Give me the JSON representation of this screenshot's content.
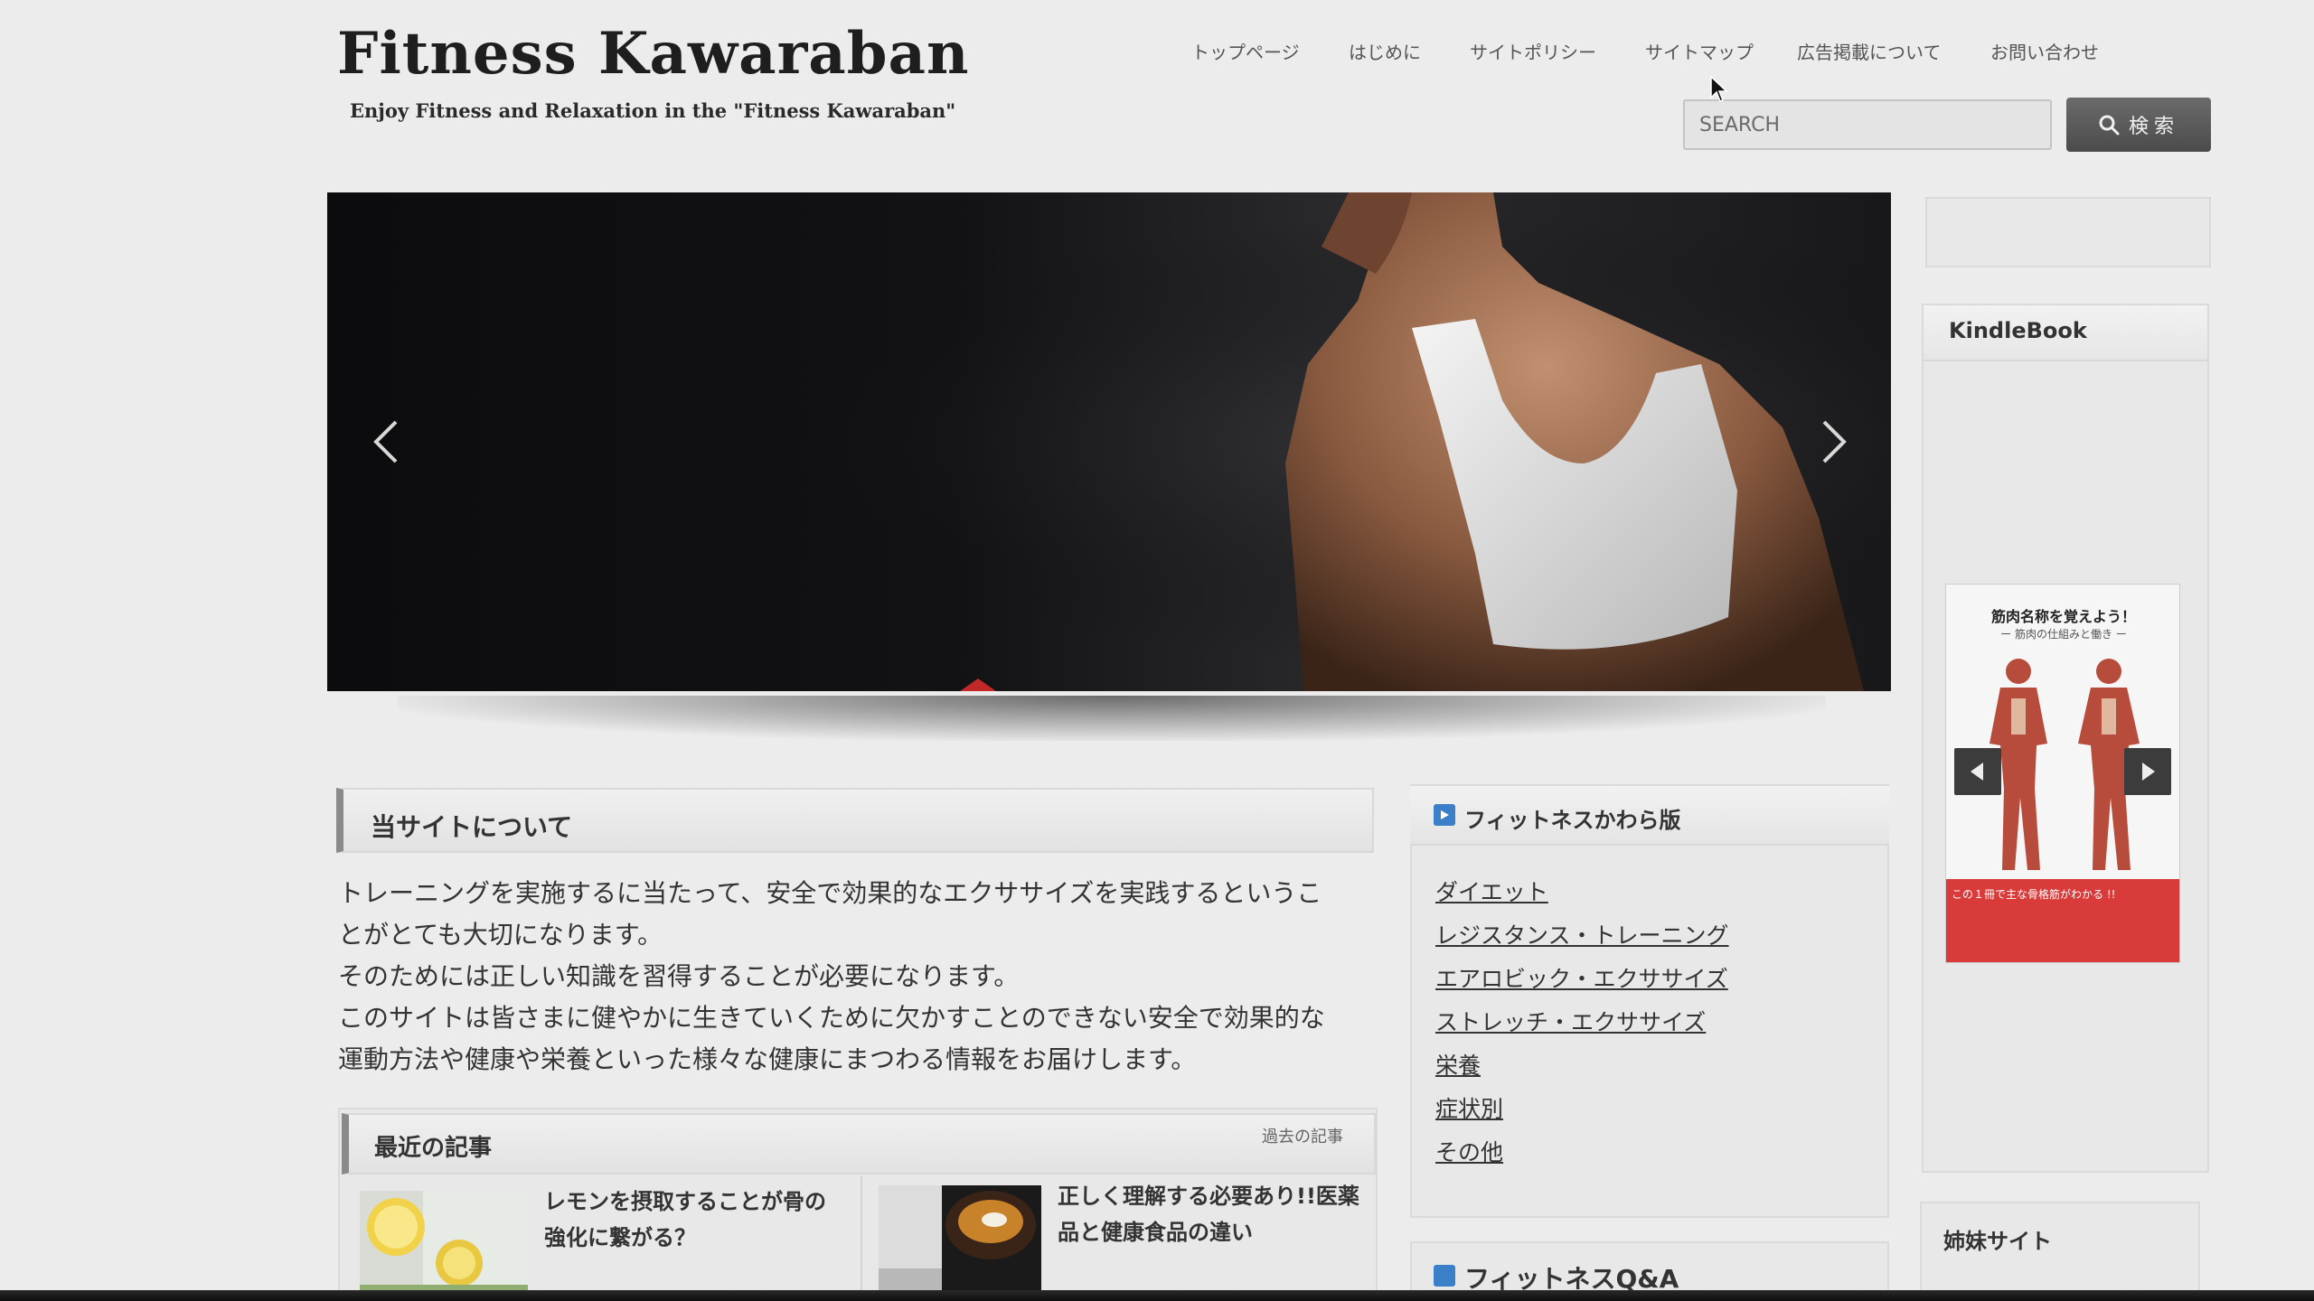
{
  "site": {
    "title": "Fitness Kawaraban",
    "tagline": "Enjoy Fitness and Relaxation in the \"Fitness Kawaraban\""
  },
  "nav": {
    "items": [
      {
        "label": "トップページ"
      },
      {
        "label": "はじめに"
      },
      {
        "label": "サイトポリシー"
      },
      {
        "label": "サイトマップ"
      },
      {
        "label": "広告掲載について"
      },
      {
        "label": "お問い合わせ"
      }
    ]
  },
  "search": {
    "placeholder": "SEARCH",
    "button_label": "検索",
    "icon": "search-icon"
  },
  "slider": {
    "prev_icon": "chevron-left-icon",
    "next_icon": "chevron-right-icon"
  },
  "about": {
    "heading": "当サイトについて",
    "lines": [
      "トレーニングを実施するに当たって、安全で効果的なエクササイズを実践するというこ",
      "とがとても大切になります。",
      "そのためには正しい知識を習得することが必要になります。",
      "このサイトは皆さまに健やかに生きていくために欠かすことのできない安全で効果的な",
      "運動方法や健康や栄養といった様々な健康にまつわる情報をお届けします。"
    ]
  },
  "recent": {
    "heading": "最近の記事",
    "past_link": "過去の記事",
    "posts": [
      {
        "title_line1": "レモンを摂取することが骨の",
        "title_line2": "強化に繋がる？"
      },
      {
        "title_line1": "正しく理解する必要あり!!医薬",
        "title_line2": "品と健康食品の違い"
      }
    ]
  },
  "categories": {
    "heading": "フィットネスかわら版",
    "items": [
      {
        "label": "ダイエット"
      },
      {
        "label": "レジスタンス・トレーニング"
      },
      {
        "label": "エアロビック・エクササイズ"
      },
      {
        "label": "ストレッチ・エクササイズ"
      },
      {
        "label": "栄養"
      },
      {
        "label": "症状別"
      },
      {
        "label": "その他"
      }
    ]
  },
  "qa": {
    "heading": "フィットネスQ&A"
  },
  "sidebar": {
    "kindle_title": "KindleBook",
    "kindle_cover_title": "筋肉名称を覚えよう！",
    "kindle_cover_subtitle": "ー 筋肉の仕組みと働き ー",
    "kindle_cover_band": "この１冊で主な骨格筋がわかる !!",
    "sister_sites_title": "姉妹サイト"
  },
  "colors": {
    "accent_blue": "#3a7fc8",
    "heading_border": "#8a8a8a",
    "search_button": "#5a5a5a"
  }
}
